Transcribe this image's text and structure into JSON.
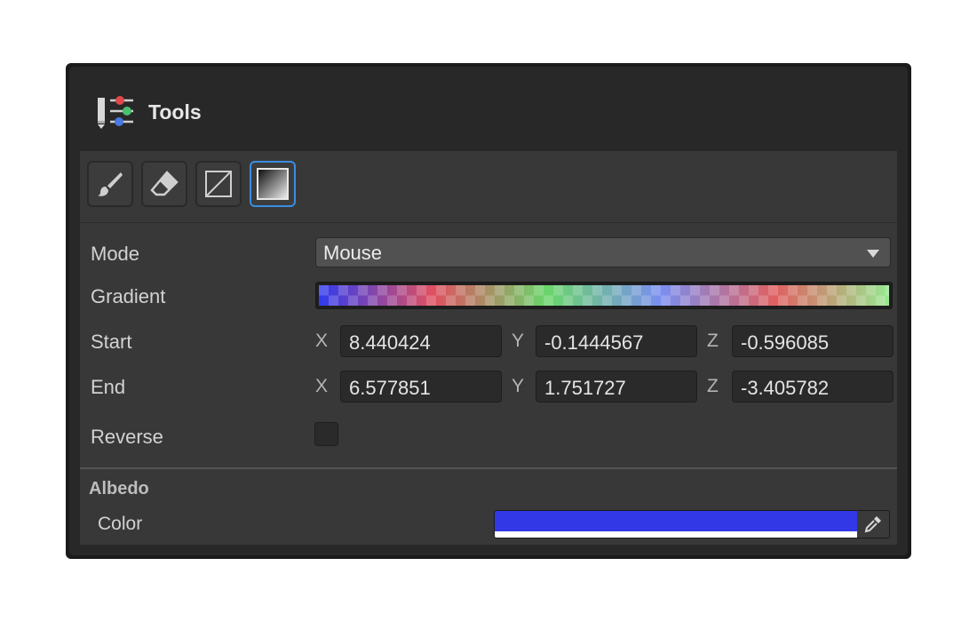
{
  "panel": {
    "title": "Tools"
  },
  "toolbar": {
    "tools": [
      {
        "id": "brush",
        "icon": "brush-icon"
      },
      {
        "id": "eraser",
        "icon": "eraser-icon"
      },
      {
        "id": "fill",
        "icon": "fill-rect-icon"
      },
      {
        "id": "gradient",
        "icon": "gradient-icon",
        "active": true
      }
    ]
  },
  "mode": {
    "label": "Mode",
    "value": "Mouse"
  },
  "gradient": {
    "label": "Gradient",
    "colors": [
      "#2f3cf0",
      "#e05060",
      "#6ad66a",
      "#7a8ef0",
      "#e06060",
      "#98e890"
    ]
  },
  "start": {
    "label": "Start",
    "x_label": "X",
    "x": "8.440424",
    "y_label": "Y",
    "y": "-0.1444567",
    "z_label": "Z",
    "z": "-0.596085"
  },
  "end": {
    "label": "End",
    "x_label": "X",
    "x": "6.577851",
    "y_label": "Y",
    "y": "1.751727",
    "z_label": "Z",
    "z": "-3.405782"
  },
  "reverse": {
    "label": "Reverse",
    "checked": false
  },
  "albedo": {
    "section_title": "Albedo",
    "color_label": "Color",
    "color_value": "#3238e6",
    "alpha": 1
  },
  "colors": {
    "accent": "#3b8de0",
    "panel_bg": "#383838",
    "header_bg": "#282828"
  }
}
